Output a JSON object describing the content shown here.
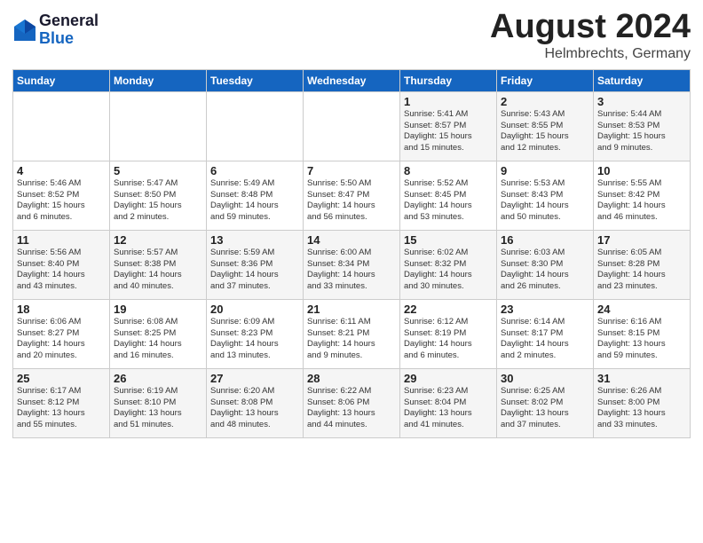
{
  "header": {
    "logo_line1": "General",
    "logo_line2": "Blue",
    "month_year": "August 2024",
    "location": "Helmbrechts, Germany"
  },
  "weekdays": [
    "Sunday",
    "Monday",
    "Tuesday",
    "Wednesday",
    "Thursday",
    "Friday",
    "Saturday"
  ],
  "weeks": [
    [
      {
        "day": "",
        "info": ""
      },
      {
        "day": "",
        "info": ""
      },
      {
        "day": "",
        "info": ""
      },
      {
        "day": "",
        "info": ""
      },
      {
        "day": "1",
        "info": "Sunrise: 5:41 AM\nSunset: 8:57 PM\nDaylight: 15 hours\nand 15 minutes."
      },
      {
        "day": "2",
        "info": "Sunrise: 5:43 AM\nSunset: 8:55 PM\nDaylight: 15 hours\nand 12 minutes."
      },
      {
        "day": "3",
        "info": "Sunrise: 5:44 AM\nSunset: 8:53 PM\nDaylight: 15 hours\nand 9 minutes."
      }
    ],
    [
      {
        "day": "4",
        "info": "Sunrise: 5:46 AM\nSunset: 8:52 PM\nDaylight: 15 hours\nand 6 minutes."
      },
      {
        "day": "5",
        "info": "Sunrise: 5:47 AM\nSunset: 8:50 PM\nDaylight: 15 hours\nand 2 minutes."
      },
      {
        "day": "6",
        "info": "Sunrise: 5:49 AM\nSunset: 8:48 PM\nDaylight: 14 hours\nand 59 minutes."
      },
      {
        "day": "7",
        "info": "Sunrise: 5:50 AM\nSunset: 8:47 PM\nDaylight: 14 hours\nand 56 minutes."
      },
      {
        "day": "8",
        "info": "Sunrise: 5:52 AM\nSunset: 8:45 PM\nDaylight: 14 hours\nand 53 minutes."
      },
      {
        "day": "9",
        "info": "Sunrise: 5:53 AM\nSunset: 8:43 PM\nDaylight: 14 hours\nand 50 minutes."
      },
      {
        "day": "10",
        "info": "Sunrise: 5:55 AM\nSunset: 8:42 PM\nDaylight: 14 hours\nand 46 minutes."
      }
    ],
    [
      {
        "day": "11",
        "info": "Sunrise: 5:56 AM\nSunset: 8:40 PM\nDaylight: 14 hours\nand 43 minutes."
      },
      {
        "day": "12",
        "info": "Sunrise: 5:57 AM\nSunset: 8:38 PM\nDaylight: 14 hours\nand 40 minutes."
      },
      {
        "day": "13",
        "info": "Sunrise: 5:59 AM\nSunset: 8:36 PM\nDaylight: 14 hours\nand 37 minutes."
      },
      {
        "day": "14",
        "info": "Sunrise: 6:00 AM\nSunset: 8:34 PM\nDaylight: 14 hours\nand 33 minutes."
      },
      {
        "day": "15",
        "info": "Sunrise: 6:02 AM\nSunset: 8:32 PM\nDaylight: 14 hours\nand 30 minutes."
      },
      {
        "day": "16",
        "info": "Sunrise: 6:03 AM\nSunset: 8:30 PM\nDaylight: 14 hours\nand 26 minutes."
      },
      {
        "day": "17",
        "info": "Sunrise: 6:05 AM\nSunset: 8:28 PM\nDaylight: 14 hours\nand 23 minutes."
      }
    ],
    [
      {
        "day": "18",
        "info": "Sunrise: 6:06 AM\nSunset: 8:27 PM\nDaylight: 14 hours\nand 20 minutes."
      },
      {
        "day": "19",
        "info": "Sunrise: 6:08 AM\nSunset: 8:25 PM\nDaylight: 14 hours\nand 16 minutes."
      },
      {
        "day": "20",
        "info": "Sunrise: 6:09 AM\nSunset: 8:23 PM\nDaylight: 14 hours\nand 13 minutes."
      },
      {
        "day": "21",
        "info": "Sunrise: 6:11 AM\nSunset: 8:21 PM\nDaylight: 14 hours\nand 9 minutes."
      },
      {
        "day": "22",
        "info": "Sunrise: 6:12 AM\nSunset: 8:19 PM\nDaylight: 14 hours\nand 6 minutes."
      },
      {
        "day": "23",
        "info": "Sunrise: 6:14 AM\nSunset: 8:17 PM\nDaylight: 14 hours\nand 2 minutes."
      },
      {
        "day": "24",
        "info": "Sunrise: 6:16 AM\nSunset: 8:15 PM\nDaylight: 13 hours\nand 59 minutes."
      }
    ],
    [
      {
        "day": "25",
        "info": "Sunrise: 6:17 AM\nSunset: 8:12 PM\nDaylight: 13 hours\nand 55 minutes."
      },
      {
        "day": "26",
        "info": "Sunrise: 6:19 AM\nSunset: 8:10 PM\nDaylight: 13 hours\nand 51 minutes."
      },
      {
        "day": "27",
        "info": "Sunrise: 6:20 AM\nSunset: 8:08 PM\nDaylight: 13 hours\nand 48 minutes."
      },
      {
        "day": "28",
        "info": "Sunrise: 6:22 AM\nSunset: 8:06 PM\nDaylight: 13 hours\nand 44 minutes."
      },
      {
        "day": "29",
        "info": "Sunrise: 6:23 AM\nSunset: 8:04 PM\nDaylight: 13 hours\nand 41 minutes."
      },
      {
        "day": "30",
        "info": "Sunrise: 6:25 AM\nSunset: 8:02 PM\nDaylight: 13 hours\nand 37 minutes."
      },
      {
        "day": "31",
        "info": "Sunrise: 6:26 AM\nSunset: 8:00 PM\nDaylight: 13 hours\nand 33 minutes."
      }
    ]
  ]
}
